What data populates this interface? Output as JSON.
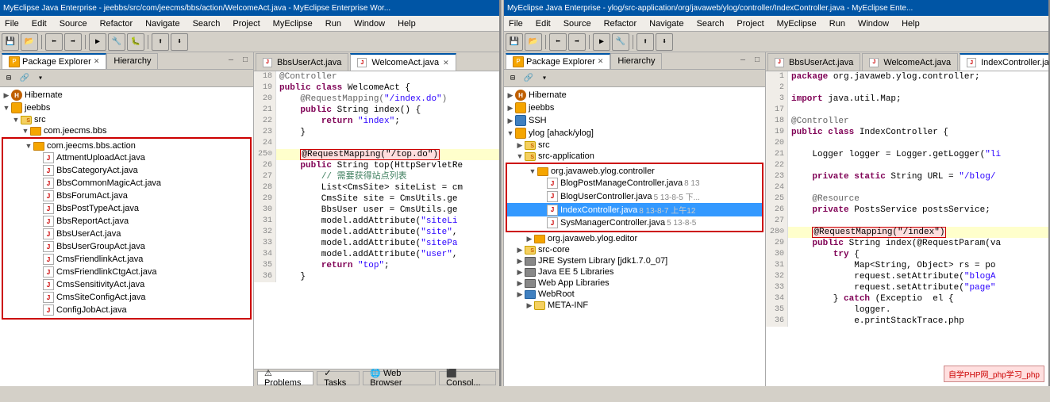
{
  "left_ide": {
    "title": "MyEclipse Java Enterprise - jeebbs/src/com/jeecms/bbs/action/WelcomeAct.java - MyEclipse Enterprise Wor...",
    "menu": [
      "File",
      "Edit",
      "Source",
      "Refactor",
      "Navigate",
      "Search",
      "Project",
      "MyEclipse",
      "Run",
      "Window",
      "Help"
    ],
    "explorer_tab": "Package Explorer",
    "hierarchy_tab": "Hierarchy",
    "tree": {
      "items": [
        {
          "label": "Hibernate",
          "indent": 0,
          "type": "hibernate",
          "expanded": true
        },
        {
          "label": "jeebbs",
          "indent": 0,
          "type": "project",
          "expanded": true
        },
        {
          "label": "src",
          "indent": 1,
          "type": "src-folder",
          "expanded": true
        },
        {
          "label": "com.jeecms.bbs",
          "indent": 2,
          "type": "package",
          "expanded": true
        },
        {
          "label": "com.jeecms.bbs.action",
          "indent": 2,
          "type": "package-red",
          "expanded": true
        },
        {
          "label": "AttmentUploadAct.java",
          "indent": 3,
          "type": "java"
        },
        {
          "label": "BbsCategoryAct.java",
          "indent": 3,
          "type": "java"
        },
        {
          "label": "BbsCommonMagicAct.java",
          "indent": 3,
          "type": "java"
        },
        {
          "label": "BbsForumAct.java",
          "indent": 3,
          "type": "java"
        },
        {
          "label": "BbsPostTypeAct.java",
          "indent": 3,
          "type": "java"
        },
        {
          "label": "BbsReportAct.java",
          "indent": 3,
          "type": "java"
        },
        {
          "label": "BbsUserAct.java",
          "indent": 3,
          "type": "java"
        },
        {
          "label": "BbsUserGroupAct.java",
          "indent": 3,
          "type": "java"
        },
        {
          "label": "CmsFriendlinkAct.java",
          "indent": 3,
          "type": "java"
        },
        {
          "label": "CmsFriendlinkCtgAct.java",
          "indent": 3,
          "type": "java"
        },
        {
          "label": "CmsSensitivityAct.java",
          "indent": 3,
          "type": "java"
        },
        {
          "label": "CmsSiteConfigAct.java",
          "indent": 3,
          "type": "java"
        },
        {
          "label": "ConfigJobAct.java",
          "indent": 3,
          "type": "java"
        }
      ]
    },
    "editor": {
      "tabs": [
        {
          "label": "BbsUserAct.java",
          "active": false
        },
        {
          "label": "WelcomeAct.java",
          "active": true
        }
      ],
      "lines": [
        {
          "num": "18",
          "content": "@Controller"
        },
        {
          "num": "19",
          "content": "public class WelcomeAct {"
        },
        {
          "num": "20",
          "content": "    @RequestMapping(\"/index.do\")"
        },
        {
          "num": "21",
          "content": "    public String index() {"
        },
        {
          "num": "22",
          "content": "        return \"index\";"
        },
        {
          "num": "23",
          "content": "    }"
        },
        {
          "num": "24",
          "content": ""
        },
        {
          "num": "25",
          "content": "    @RequestMapping(\"/top.do\")  ← highlighted"
        },
        {
          "num": "26",
          "content": "    public String top(HttpServletRe"
        },
        {
          "num": "27",
          "content": "        // 需要获得站点列表"
        },
        {
          "num": "28",
          "content": "        List<CmsSite> siteList = cm"
        },
        {
          "num": "29",
          "content": "        CmsSite site = CmsUtils.ge"
        },
        {
          "num": "30",
          "content": "        BbsUser user = CmsUtils.ge"
        },
        {
          "num": "31",
          "content": "        model.addAttribute(\"siteLi"
        },
        {
          "num": "32",
          "content": "        model.addAttribute(\"site\","
        },
        {
          "num": "33",
          "content": "        model.addAttribute(\"sitePa"
        },
        {
          "num": "34",
          "content": "        model.addAttribute(\"user\","
        },
        {
          "num": "35",
          "content": "        return \"top\";"
        },
        {
          "num": "36",
          "content": "    }"
        }
      ]
    }
  },
  "right_ide": {
    "title": "MyEclipse Java Enterprise - ylog/src-application/org/javaweb/ylog/controller/IndexController.java - MyEclipse Ente...",
    "menu": [
      "File",
      "Edit",
      "Source",
      "Refactor",
      "Navigate",
      "Search",
      "Project",
      "MyEclipse",
      "Run",
      "Window",
      "Help"
    ],
    "explorer_tab": "Package Explorer",
    "hierarchy_tab": "Hierarchy",
    "tree": {
      "items": [
        {
          "label": "Hibernate",
          "indent": 0,
          "type": "hibernate",
          "expanded": true
        },
        {
          "label": "jeebbs",
          "indent": 0,
          "type": "project",
          "expanded": false
        },
        {
          "label": "SSH",
          "indent": 0,
          "type": "project",
          "expanded": false
        },
        {
          "label": "ylog [ahack/ylog]",
          "indent": 0,
          "type": "project",
          "expanded": true
        },
        {
          "label": "src",
          "indent": 1,
          "type": "src-folder",
          "expanded": false
        },
        {
          "label": "src-application",
          "indent": 1,
          "type": "src-folder",
          "expanded": true
        },
        {
          "label": "org.javaweb.ylog.controller",
          "indent": 2,
          "type": "package-red",
          "expanded": true
        },
        {
          "label": "BlogPostManageController.java",
          "indent": 3,
          "type": "java",
          "badge": "8 13"
        },
        {
          "label": "BlogUserController.java",
          "indent": 3,
          "type": "java",
          "badge": "5 13-8-5 下..."
        },
        {
          "label": "IndexController.java",
          "indent": 3,
          "type": "java",
          "badge": "8 13-8-7 上午12",
          "selected": true
        },
        {
          "label": "SysManagerController.java",
          "indent": 3,
          "type": "java",
          "badge": "5 13-8-5"
        },
        {
          "label": "org.javaweb.ylog.editor",
          "indent": 2,
          "type": "package"
        },
        {
          "label": "src-core",
          "indent": 1,
          "type": "src-folder"
        },
        {
          "label": "JRE System Library [jdk1.7.0_07]",
          "indent": 1,
          "type": "lib"
        },
        {
          "label": "Java EE 5 Libraries",
          "indent": 1,
          "type": "lib"
        },
        {
          "label": "Web App Libraries",
          "indent": 1,
          "type": "lib"
        },
        {
          "label": "WebRoot",
          "indent": 1,
          "type": "folder"
        },
        {
          "label": "META-INF",
          "indent": 2,
          "type": "folder"
        }
      ]
    },
    "editor": {
      "tabs": [
        {
          "label": "BbsUserAct.java",
          "active": false
        },
        {
          "label": "WelcomeAct.java",
          "active": false
        },
        {
          "label": "IndexController.java",
          "active": true
        }
      ],
      "lines": [
        {
          "num": "1",
          "content": "package org.javaweb.ylog.controller;"
        },
        {
          "num": "2",
          "content": ""
        },
        {
          "num": "3",
          "content": "import java.util.Map;"
        },
        {
          "num": "17",
          "content": ""
        },
        {
          "num": "18",
          "content": "@Controller"
        },
        {
          "num": "19",
          "content": "public class IndexController {"
        },
        {
          "num": "20",
          "content": ""
        },
        {
          "num": "21",
          "content": "    Logger logger = Logger.getLogger(\"li"
        },
        {
          "num": "22",
          "content": ""
        },
        {
          "num": "23",
          "content": "    private static String URL = \"/blog/"
        },
        {
          "num": "24",
          "content": ""
        },
        {
          "num": "25",
          "content": "    @Resource"
        },
        {
          "num": "26",
          "content": "    private PostsService postsService;"
        },
        {
          "num": "27",
          "content": ""
        },
        {
          "num": "28",
          "content": "    @RequestMapping(\"/index\")  ← highlighted"
        },
        {
          "num": "29",
          "content": "    public String index(@RequestParam(va"
        },
        {
          "num": "30",
          "content": "        try {"
        },
        {
          "num": "31",
          "content": "            Map<String, Object> rs = po"
        },
        {
          "num": "32",
          "content": "            request.setAttribute(\"blogA"
        },
        {
          "num": "33",
          "content": "            request.setAttribute(\"page\""
        },
        {
          "num": "34",
          "content": "        } catch (Exceptio  el {"
        },
        {
          "num": "35",
          "content": "            logger."
        },
        {
          "num": "36",
          "content": "            e.printStackTrace.php"
        }
      ]
    }
  },
  "bottom_tabs": {
    "left": [
      "Problems",
      "Tasks",
      "Web Browser",
      "Consol..."
    ],
    "right": []
  },
  "watermark": {
    "text": "自学PHP网_php学习_php"
  }
}
